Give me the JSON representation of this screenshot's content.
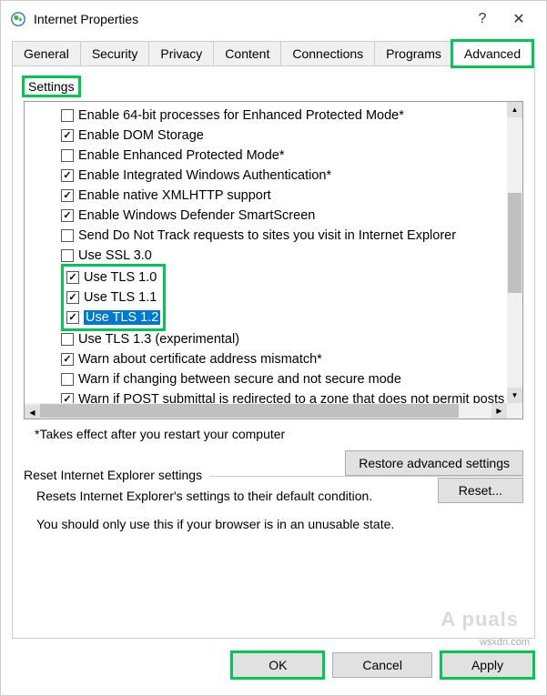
{
  "window": {
    "title": "Internet Properties",
    "help": "?",
    "close": "✕"
  },
  "tabs": [
    "General",
    "Security",
    "Privacy",
    "Content",
    "Connections",
    "Programs",
    "Advanced"
  ],
  "activeTab": "Advanced",
  "settingsLabel": "Settings",
  "items": [
    {
      "label": "Enable 64-bit processes for Enhanced Protected Mode*",
      "checked": false
    },
    {
      "label": "Enable DOM Storage",
      "checked": true
    },
    {
      "label": "Enable Enhanced Protected Mode*",
      "checked": false
    },
    {
      "label": "Enable Integrated Windows Authentication*",
      "checked": true
    },
    {
      "label": "Enable native XMLHTTP support",
      "checked": true
    },
    {
      "label": "Enable Windows Defender SmartScreen",
      "checked": true
    },
    {
      "label": "Send Do Not Track requests to sites you visit in Internet Explorer",
      "checked": false
    },
    {
      "label": "Use SSL 3.0",
      "checked": false
    },
    {
      "label": "Use TLS 1.0",
      "checked": true,
      "highlight": true
    },
    {
      "label": "Use TLS 1.1",
      "checked": true,
      "highlight": true
    },
    {
      "label": "Use TLS 1.2",
      "checked": true,
      "highlight": true,
      "selected": true
    },
    {
      "label": "Use TLS 1.3 (experimental)",
      "checked": false
    },
    {
      "label": "Warn about certificate address mismatch*",
      "checked": true
    },
    {
      "label": "Warn if changing between secure and not secure mode",
      "checked": false
    },
    {
      "label": "Warn if POST submittal is redirected to a zone that does not permit posts",
      "checked": true
    }
  ],
  "note": "*Takes effect after you restart your computer",
  "restoreButton": "Restore advanced settings",
  "resetGroup": {
    "label": "Reset Internet Explorer settings",
    "desc": "Resets Internet Explorer's settings to their default condition.",
    "button": "Reset...",
    "warning": "You should only use this if your browser is in an unusable state."
  },
  "dialogButtons": {
    "ok": "OK",
    "cancel": "Cancel",
    "apply": "Apply"
  },
  "watermark": "wsxdn.com",
  "watermark2": "A  puals"
}
